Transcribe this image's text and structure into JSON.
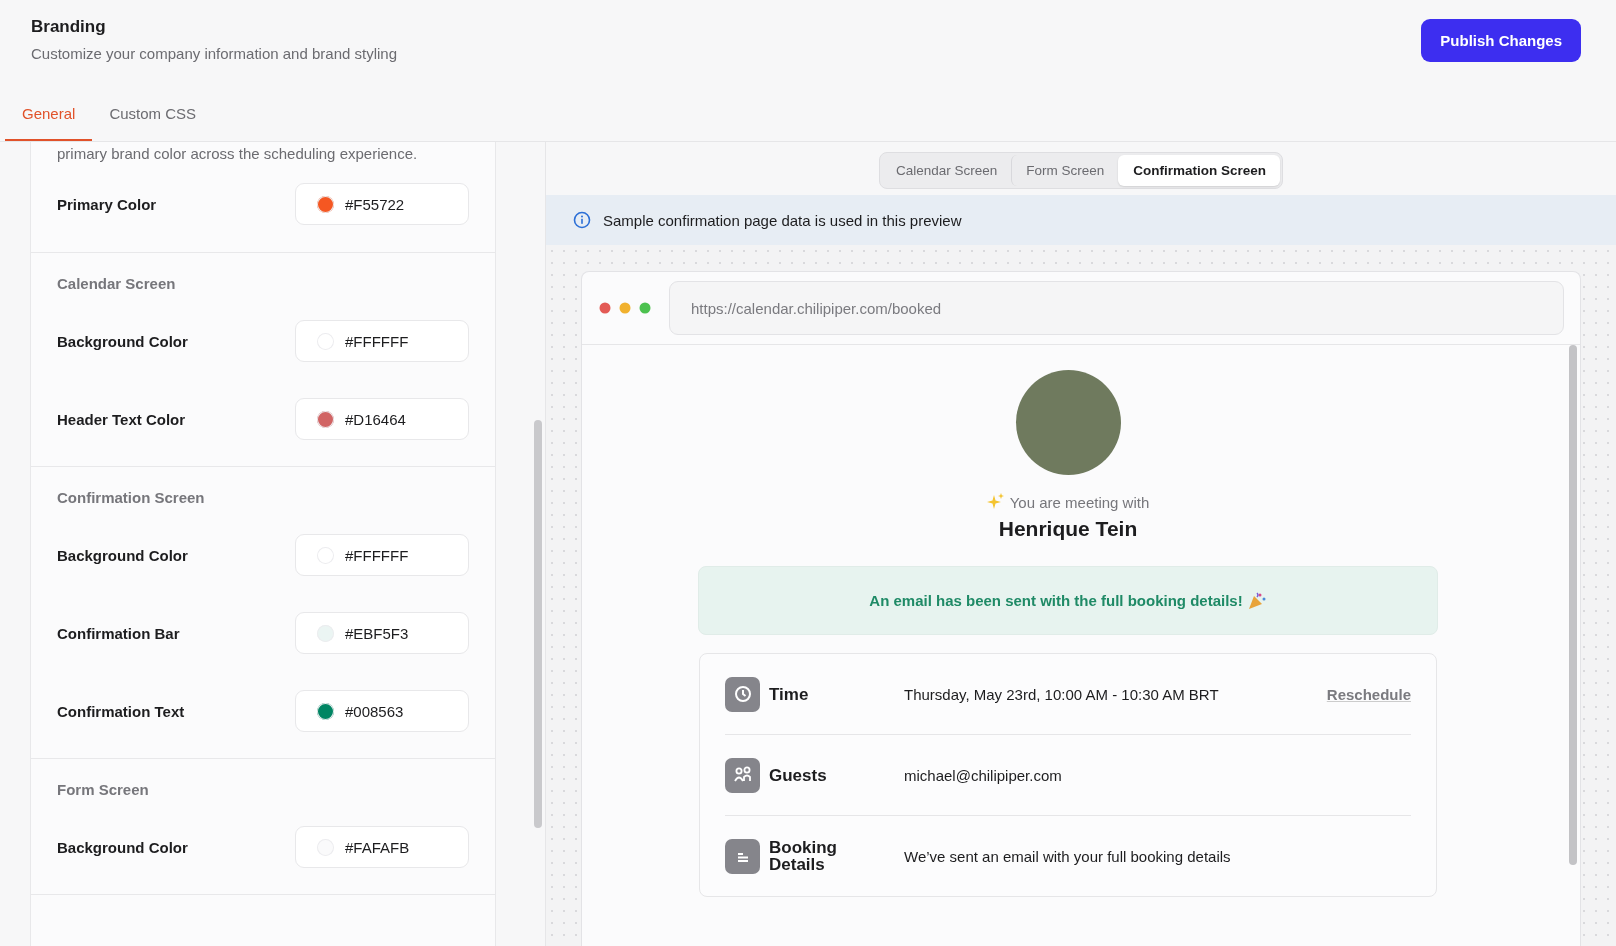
{
  "header": {
    "title": "Branding",
    "subtitle": "Customize your company information and brand styling",
    "publish_button": "Publish Changes"
  },
  "tabs": [
    {
      "label": "General",
      "selected": true
    },
    {
      "label": "Custom CSS",
      "selected": false
    }
  ],
  "sections": [
    {
      "description": "primary brand color across the scheduling experience.",
      "fields": [
        {
          "label": "Primary Color",
          "value": "#F55722",
          "color": "#f55722"
        }
      ]
    },
    {
      "title": "Calendar Screen",
      "fields": [
        {
          "label": "Background Color",
          "value": "#FFFFFF",
          "color": "#ffffff"
        },
        {
          "label": "Header Text Color",
          "value": "#D16464",
          "color": "#d16464"
        }
      ]
    },
    {
      "title": "Confirmation Screen",
      "fields": [
        {
          "label": "Background Color",
          "value": "#FFFFFF",
          "color": "#ffffff"
        },
        {
          "label": "Confirmation Bar",
          "value": "#EBF5F3",
          "color": "#ebf5f3"
        },
        {
          "label": "Confirmation Text",
          "value": "#008563",
          "color": "#008563"
        }
      ]
    },
    {
      "title": "Form Screen",
      "fields": [
        {
          "label": "Background Color",
          "value": "#FAFAFB",
          "color": "#fafafb"
        }
      ]
    }
  ],
  "preview": {
    "screen_tabs": [
      {
        "label": "Calendar Screen",
        "selected": false
      },
      {
        "label": "Form Screen",
        "selected": false
      },
      {
        "label": "Confirmation Screen",
        "selected": true
      }
    ],
    "info": "Sample confirmation page data is used in this preview",
    "browser": {
      "url": "https://calendar.chilipiper.com/booked"
    },
    "meeting_with": "You are meeting with",
    "host_name": "Henrique Tein",
    "confirmation": "An email has been sent with the full booking details!",
    "details": [
      {
        "kind": "time",
        "label": "Time",
        "value": "Thursday, May 23rd, 10:00 AM - 10:30 AM BRT",
        "action": "Reschedule"
      },
      {
        "kind": "guests",
        "label": "Guests",
        "value": "michael@chilipiper.com"
      },
      {
        "kind": "booking",
        "label": "Booking Details",
        "value": "We’ve sent an email with your full booking details"
      }
    ]
  }
}
